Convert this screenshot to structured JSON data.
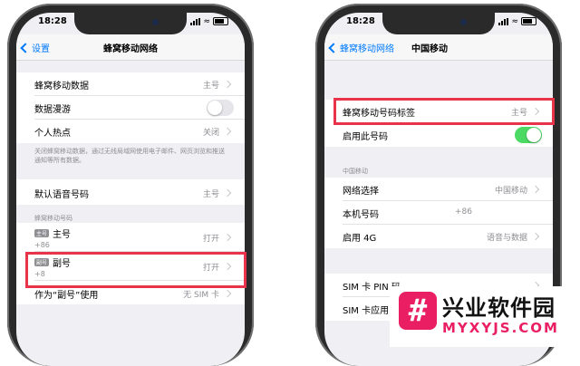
{
  "colors": {
    "accent": "#007aff",
    "toggle_on": "#4cd964",
    "highlight": "#e8334a",
    "watermark": "#e91e63"
  },
  "left": {
    "status_time": "18:28",
    "back_label": "设置",
    "title": "蜂窝移动网络",
    "rows": {
      "cellular_data": {
        "label": "蜂窝移动数据",
        "value": "主号"
      },
      "roaming": {
        "label": "数据漫游",
        "toggle": "off"
      },
      "hotspot": {
        "label": "个人热点",
        "value": "关闭"
      },
      "voice": {
        "label": "默认语音号码",
        "value": "主号"
      },
      "primary": {
        "tag": "主号",
        "label": "主号",
        "sub": "+86",
        "value": "打开"
      },
      "secondary": {
        "tag": "副号",
        "label": "副号",
        "sub": "+8",
        "value": "打开"
      },
      "use_as": {
        "label": "作为“副号”使用",
        "value": "无 SIM 卡"
      }
    },
    "note": "关闭蜂窝移动数据，通过无线局域网使用电子邮件、网页浏览和推送通知等所有数据。",
    "section_plans": "蜂窝移动号码"
  },
  "right": {
    "status_time": "18:28",
    "back_label": "蜂窝移动网络",
    "title": "中国移动",
    "rows": {
      "label_row": {
        "label": "蜂窝移动号码标签",
        "value": "主号"
      },
      "enable": {
        "label": "启用此号码",
        "toggle": "on"
      },
      "network": {
        "label": "网络选择",
        "value": "中国移动"
      },
      "my_number": {
        "label": "本机号码",
        "value": "+86"
      },
      "enable_4g": {
        "label": "启用 4G",
        "value": "语音与数据"
      },
      "sim_pin": {
        "label": "SIM 卡 PIN 码"
      },
      "sim_apps": {
        "label": "SIM 卡应用"
      }
    },
    "section_carrier": "中国移动"
  },
  "watermark": {
    "icon": "#",
    "title": "兴业软件园",
    "subtitle": "MYXYJS.COM"
  }
}
